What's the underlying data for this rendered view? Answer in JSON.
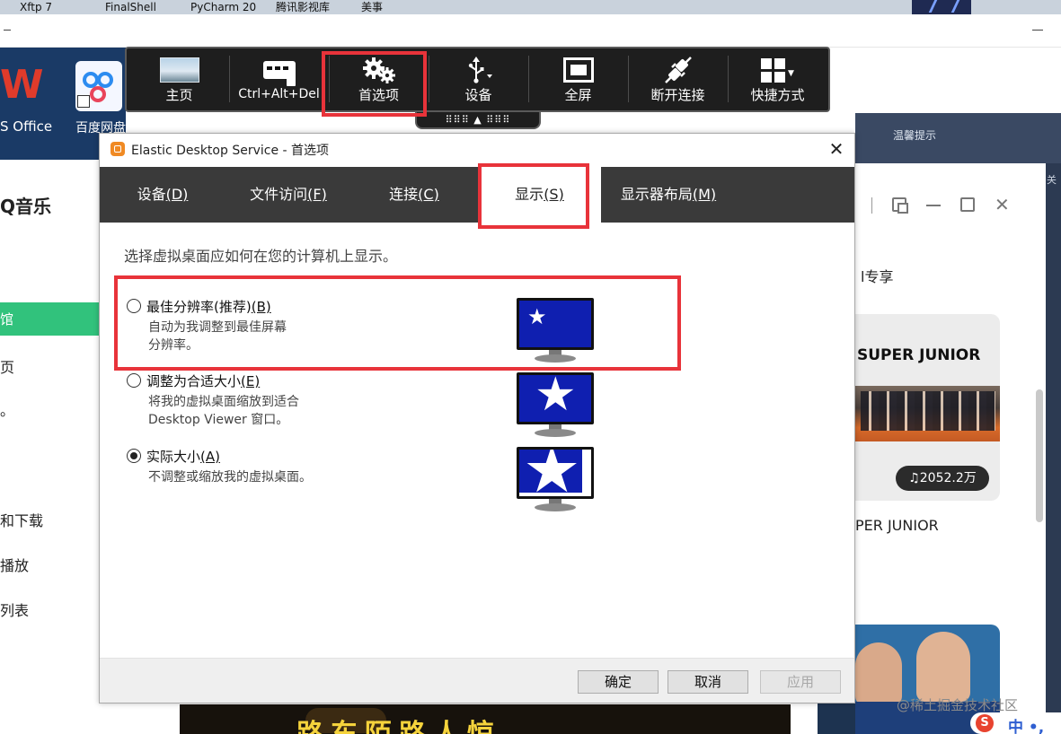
{
  "taskbar": {
    "items": [
      "Xftp 7",
      "FinalShell",
      "PyCharm 20...",
      "腾讯影视库",
      "美事"
    ]
  },
  "desktop": {
    "wps_label": "S Office",
    "baidu_label": "百度网盘",
    "qq_title": "Q音乐",
    "qq_active_item": "馆",
    "qq_side_items": [
      "页",
      "。",
      "和下载",
      "播放",
      "列表"
    ],
    "right_panel_title": "温馨提示",
    "right_panel_sub": "关",
    "exclusive_label": "l专享",
    "card_title": "SUPER JUNIOR",
    "play_count": "♫2052.2万",
    "card_caption": "PER JUNIOR",
    "bottom_text": "路东陌路人惊",
    "watermark": "@稀土掘金技术社区",
    "ime_logo": "S",
    "ime_text": "中 •,"
  },
  "toolbar": {
    "buttons": [
      {
        "label": "主页",
        "icon": "home-thumbnail-icon"
      },
      {
        "label": "Ctrl+Alt+Del",
        "icon": "keyboard-icon"
      },
      {
        "label": "首选项",
        "icon": "gears-icon"
      },
      {
        "label": "设备",
        "icon": "usb-icon"
      },
      {
        "label": "全屏",
        "icon": "fullscreen-icon"
      },
      {
        "label": "断开连接",
        "icon": "disconnect-plug-icon"
      },
      {
        "label": "快捷方式",
        "icon": "grid-icon"
      }
    ],
    "handle_text": "⠿⠿⠿ ▲ ⠿⠿⠿"
  },
  "dialog": {
    "title": "Elastic Desktop Service - 首选项",
    "close_glyph": "✕",
    "tabs": [
      {
        "label": "设备",
        "key": "(D)"
      },
      {
        "label": "文件访问",
        "key": "(F)"
      },
      {
        "label": "连接",
        "key": "(C)"
      },
      {
        "label": "显示",
        "key": "(S)"
      },
      {
        "label": "显示器布局",
        "key": "(M)"
      }
    ],
    "active_tab": "显示",
    "instruction": "选择虚拟桌面应如何在您的计算机上显示。",
    "options": [
      {
        "label": "最佳分辨率(推荐)",
        "key": "(B)",
        "desc_line1": "自动为我调整到最佳屏幕",
        "desc_line2": "分辨率。",
        "checked": false
      },
      {
        "label": "调整为合适大小",
        "key": "(E)",
        "desc_line1": "将我的虚拟桌面缩放到适合",
        "desc_line2": "Desktop  Viewer 窗口。",
        "checked": false
      },
      {
        "label": "实际大小",
        "key": "(A)",
        "desc_line1": "不调整或缩放我的虚拟桌面。",
        "desc_line2": "",
        "checked": true
      }
    ],
    "buttons": {
      "ok": "确定",
      "cancel": "取消",
      "apply": "应用"
    }
  },
  "colors": {
    "highlight": "#e8333a",
    "tab_bar": "#3a3a3a",
    "monitor_blue": "#0f1fb0",
    "qq_green": "#31c27c"
  }
}
